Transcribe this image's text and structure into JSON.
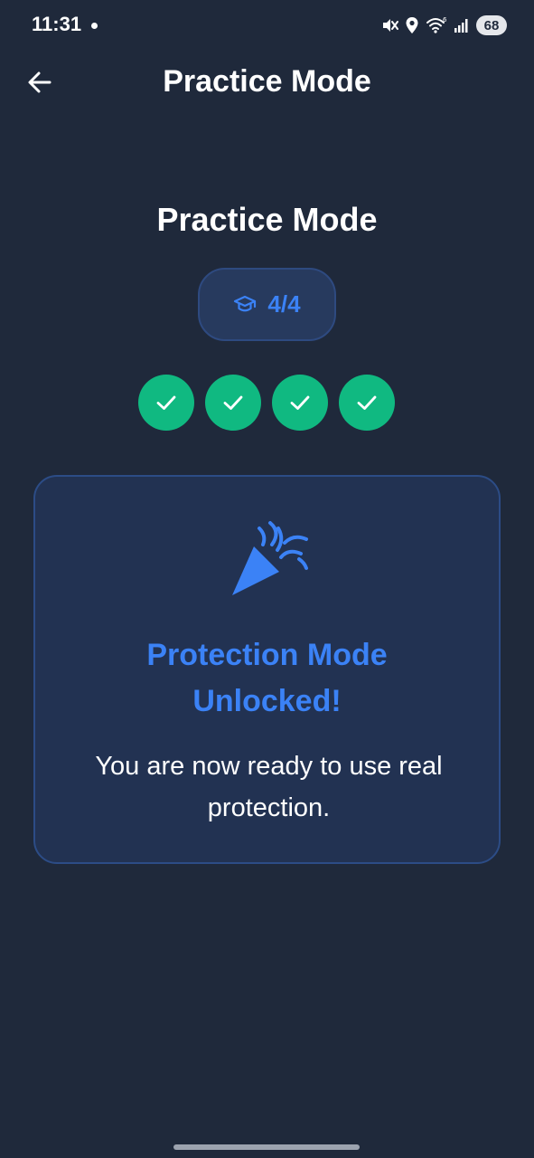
{
  "status_bar": {
    "time": "11:31",
    "battery": "68",
    "icons": [
      "mute-icon",
      "location-icon",
      "wifi-icon",
      "signal-icon"
    ]
  },
  "app_bar": {
    "title": "Practice Mode",
    "back_icon": "arrow-left-icon"
  },
  "main": {
    "heading": "Practice Mode",
    "progress": {
      "icon": "graduation-cap-icon",
      "label": "4/4",
      "completed": 4,
      "total": 4
    },
    "steps": [
      {
        "status": "complete",
        "icon": "check-icon"
      },
      {
        "status": "complete",
        "icon": "check-icon"
      },
      {
        "status": "complete",
        "icon": "check-icon"
      },
      {
        "status": "complete",
        "icon": "check-icon"
      }
    ],
    "unlock_card": {
      "icon": "party-popper-icon",
      "title_line1": "Protection Mode",
      "title_line2": "Unlocked!",
      "message_line1": "You are now ready to use real",
      "message_line2": "protection."
    }
  },
  "colors": {
    "background": "#1f293b",
    "accent_blue": "#3b82f6",
    "success_green": "#10b981",
    "card_background": "#223252"
  }
}
